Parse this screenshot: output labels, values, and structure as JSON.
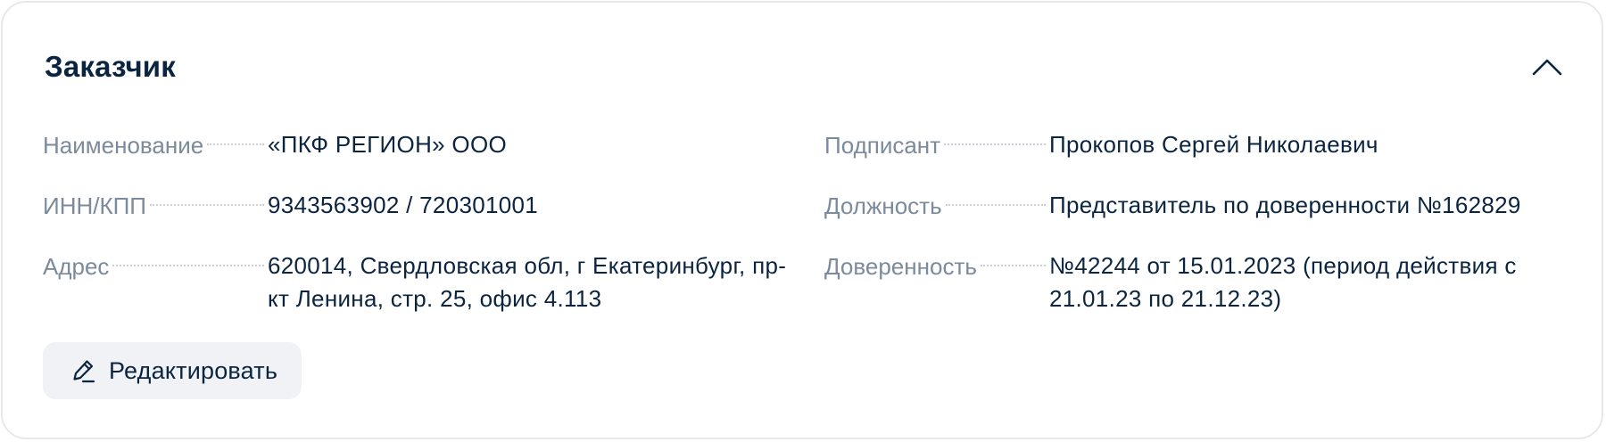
{
  "card": {
    "title": "Заказчик",
    "collapse_icon": "chevron-up-icon"
  },
  "customer": {
    "left": [
      {
        "label": "Наименование",
        "value": "«ПКФ РЕГИОН» ООО"
      },
      {
        "label": "ИНН/КПП",
        "value": "9343563902 / 720301001"
      },
      {
        "label": "Адрес",
        "value": "620014, Свердловская обл, г Екатеринбург, пр-кт Ленина, стр. 25, офис 4.113"
      }
    ],
    "right": [
      {
        "label": "Подписант",
        "value": "Прокопов Сергей Николаевич"
      },
      {
        "label": "Должность",
        "value": "Представитель по доверенности №162829"
      },
      {
        "label": "Доверенность",
        "value": "№42244 от 15.01.2023 (период действия с 21.01.23 по 21.12.23)"
      }
    ]
  },
  "actions": {
    "edit_label": "Редактировать",
    "edit_icon": "pencil-icon"
  },
  "colors": {
    "title": "#0b2540",
    "label": "#7b8a9c",
    "value": "#0b2540",
    "button_bg": "#f0f2f5",
    "border": "#e6e8ec"
  }
}
